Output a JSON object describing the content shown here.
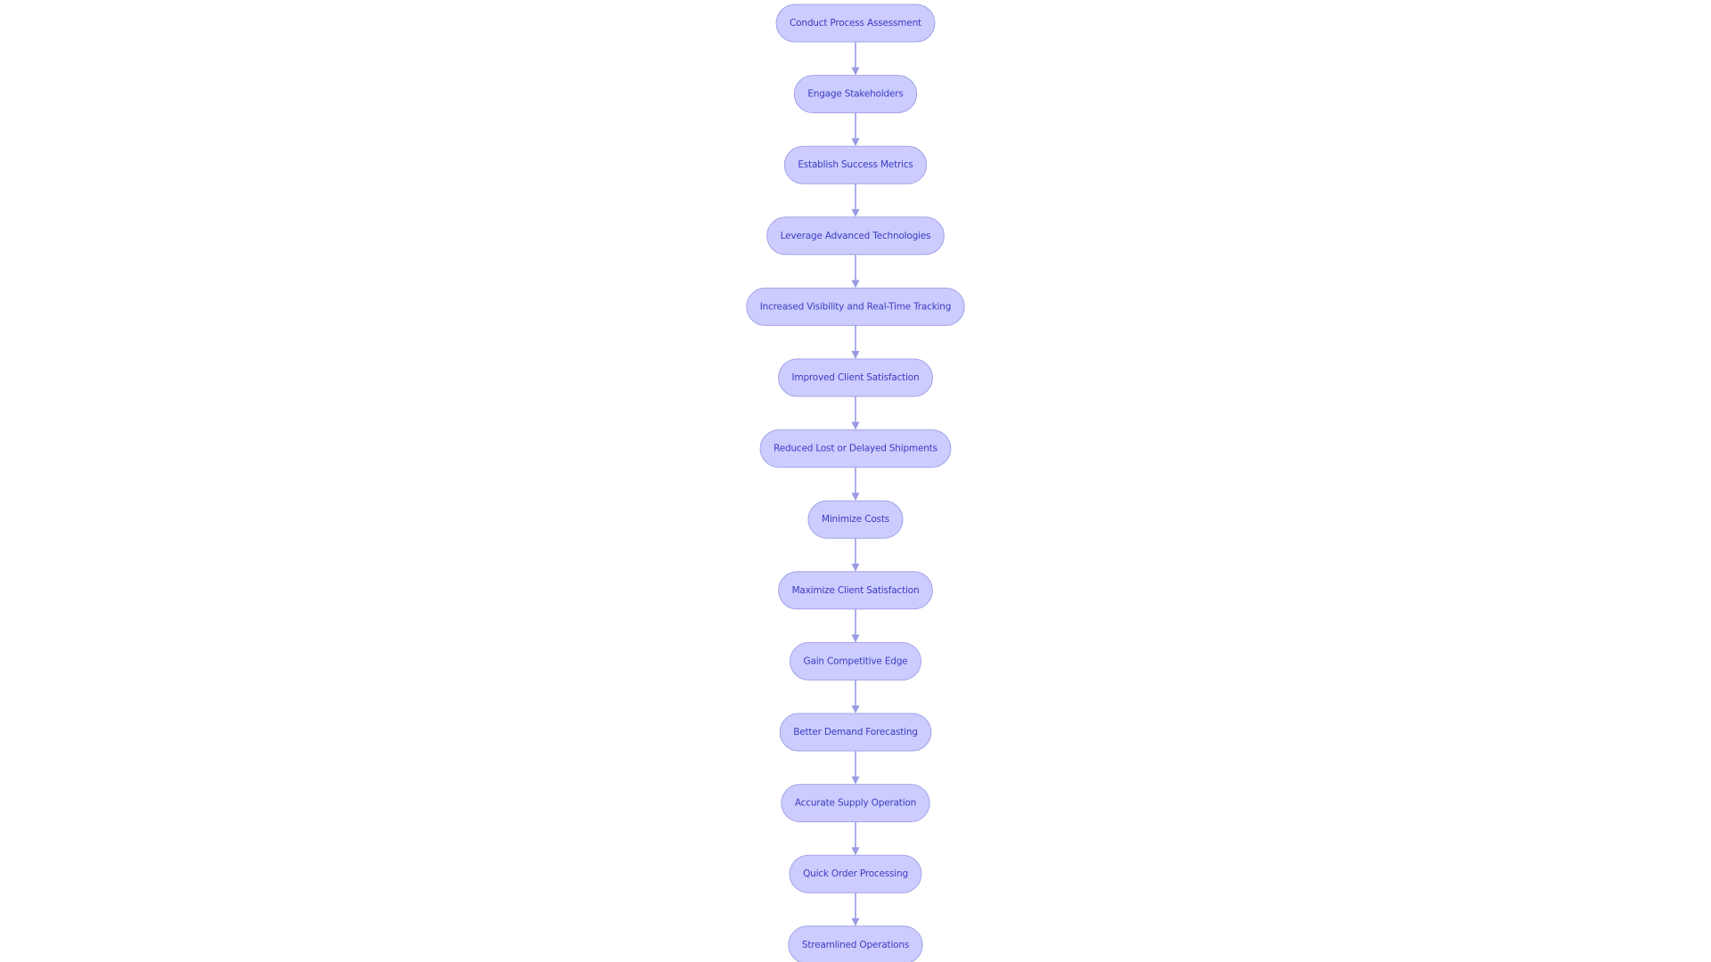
{
  "diagram": {
    "type": "flowchart",
    "direction": "top-to-bottom",
    "colors": {
      "node_fill": "#ccccff",
      "node_border": "#a3a3e8",
      "node_text": "#3c3cc2",
      "edge": "#9a9ae4",
      "background": "#ffffff"
    },
    "nodes": [
      {
        "id": "n1",
        "label": "Conduct Process Assessment"
      },
      {
        "id": "n2",
        "label": "Engage Stakeholders"
      },
      {
        "id": "n3",
        "label": "Establish Success Metrics"
      },
      {
        "id": "n4",
        "label": "Leverage Advanced Technologies"
      },
      {
        "id": "n5",
        "label": "Increased Visibility and Real-Time Tracking"
      },
      {
        "id": "n6",
        "label": "Improved Client Satisfaction"
      },
      {
        "id": "n7",
        "label": "Reduced Lost or Delayed Shipments"
      },
      {
        "id": "n8",
        "label": "Minimize Costs"
      },
      {
        "id": "n9",
        "label": "Maximize Client Satisfaction"
      },
      {
        "id": "n10",
        "label": "Gain Competitive Edge"
      },
      {
        "id": "n11",
        "label": "Better Demand Forecasting"
      },
      {
        "id": "n12",
        "label": "Accurate Supply Operation"
      },
      {
        "id": "n13",
        "label": "Quick Order Processing"
      },
      {
        "id": "n14",
        "label": "Streamlined Operations"
      }
    ],
    "edges": [
      {
        "from": "n1",
        "to": "n2"
      },
      {
        "from": "n2",
        "to": "n3"
      },
      {
        "from": "n3",
        "to": "n4"
      },
      {
        "from": "n4",
        "to": "n5"
      },
      {
        "from": "n5",
        "to": "n6"
      },
      {
        "from": "n6",
        "to": "n7"
      },
      {
        "from": "n7",
        "to": "n8"
      },
      {
        "from": "n8",
        "to": "n9"
      },
      {
        "from": "n9",
        "to": "n10"
      },
      {
        "from": "n10",
        "to": "n11"
      },
      {
        "from": "n11",
        "to": "n12"
      },
      {
        "from": "n12",
        "to": "n13"
      },
      {
        "from": "n13",
        "to": "n14"
      }
    ]
  }
}
